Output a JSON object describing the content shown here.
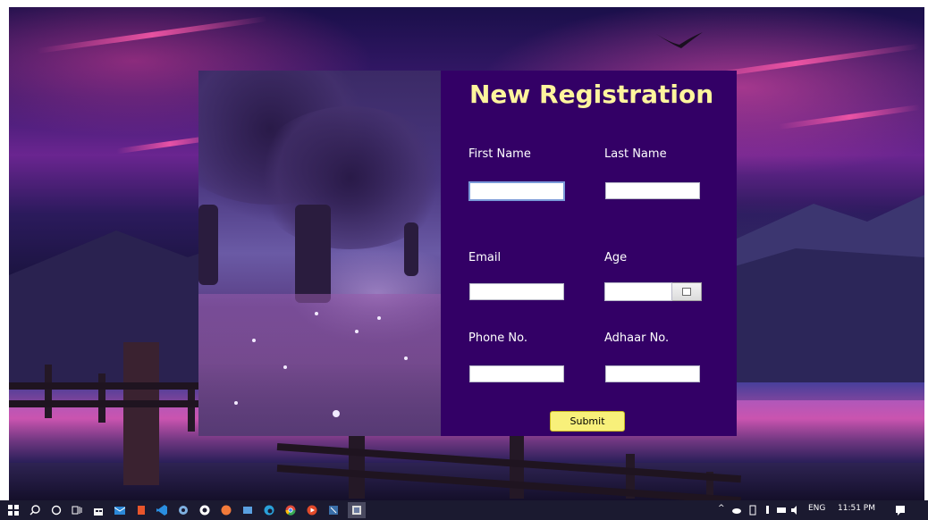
{
  "form": {
    "title": "New Registration",
    "fields": {
      "first_name": {
        "label": "First Name",
        "value": ""
      },
      "last_name": {
        "label": "Last Name",
        "value": ""
      },
      "email": {
        "label": "Email",
        "value": ""
      },
      "age": {
        "label": "Age",
        "value": ""
      },
      "phone": {
        "label": "Phone No.",
        "value": ""
      },
      "adhaar": {
        "label": "Adhaar No.",
        "value": ""
      }
    },
    "submit_label": "Submit"
  },
  "colors": {
    "form_background": "#330066",
    "title": "#fff59d",
    "submit_background": "#f8f07a"
  },
  "taskbar": {
    "apps": [
      "start-icon",
      "search-icon",
      "cortana-icon",
      "task-view-icon",
      "store-icon",
      "mail-icon",
      "office-icon",
      "vscode-icon",
      "settings-icon",
      "github-icon",
      "app-orange-icon",
      "photos-icon",
      "edge-icon",
      "chrome-icon",
      "media-icon",
      "snipping-icon",
      "java-app-icon"
    ],
    "tray": {
      "language": "ENG",
      "time": "11:51 PM"
    }
  }
}
